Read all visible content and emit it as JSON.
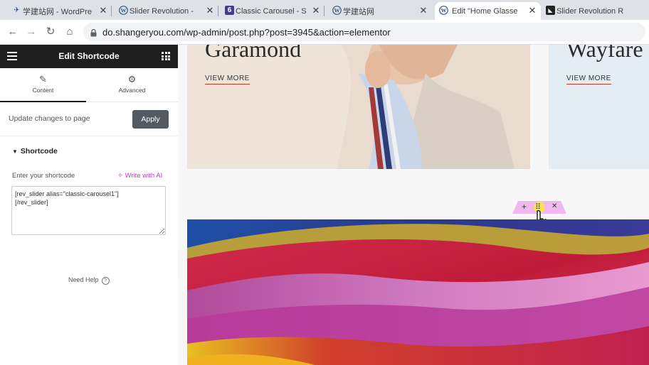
{
  "browser": {
    "tabs": [
      {
        "icon": "xuejian-icon",
        "label": "学建站网 - WordPre",
        "close": "✕"
      },
      {
        "icon": "wordpress-icon",
        "label": "Slider Revolution -",
        "close": "✕"
      },
      {
        "icon": "six-icon",
        "label": "Classic Carousel - S",
        "close": "✕"
      },
      {
        "icon": "wordpress-icon",
        "label": "学建站网",
        "close": "✕"
      },
      {
        "icon": "wordpress-icon",
        "label": "Edit \"Home Glasse",
        "close": "✕"
      },
      {
        "icon": "slider-revolution-icon",
        "label": "Slider Revolution R",
        "close": ""
      }
    ],
    "active_tab": 4,
    "url": "do.shangeryou.com/wp-admin/post.php?post=3945&action=elementor"
  },
  "panel": {
    "title": "Edit Shortcode",
    "tabs": [
      {
        "icon": "pencil-icon",
        "label": "Content"
      },
      {
        "icon": "gear-icon",
        "label": "Advanced"
      }
    ],
    "update_text": "Update changes to page",
    "apply_label": "Apply",
    "section_title": "Shortcode",
    "field_label": "Enter your shortcode",
    "write_ai_label": "Write with AI",
    "shortcode_value": "[rev_slider alias=\"classic-carousel1\"]\n[/rev_slider]",
    "help_label": "Need Help"
  },
  "preview": {
    "card1": {
      "title": "Garamond",
      "link": "VIEW MORE"
    },
    "card2": {
      "title": "Wayfare",
      "link": "VIEW MORE"
    },
    "toolbar": {
      "add": "+",
      "drag": "⠿",
      "close": "✕"
    }
  },
  "colors": {
    "panel_header": "#1f1f1f",
    "apply_button": "#545a62",
    "ai_accent": "#c036d0",
    "toolbar_pink": "#f0b8f0",
    "link_underline": "#c0392b"
  }
}
